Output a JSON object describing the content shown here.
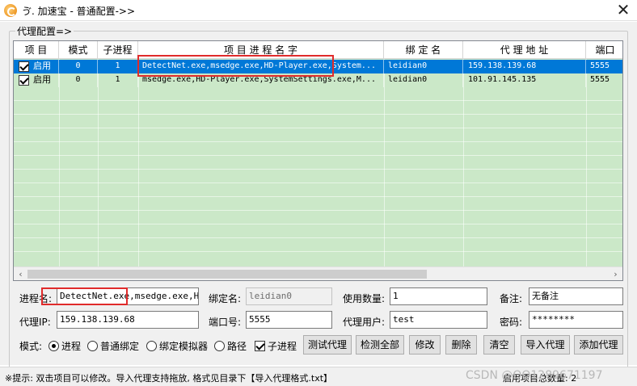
{
  "window": {
    "title": "ゔ. 加速宝 - 普通配置->>",
    "close_symbol": "✕"
  },
  "group_label": "代理配置=>",
  "table": {
    "headers": [
      "项 目",
      "模式",
      "子进程",
      "项 目 进 程 名 字",
      "绑 定 名",
      "代 理 地 址",
      "端口"
    ],
    "rows": [
      {
        "enabled": "启用",
        "mode": "0",
        "sub": "1",
        "processes": "DetectNet.exe,msedge.exe,HD-Player.exe,System...",
        "bind": "leidian0",
        "address": "159.138.139.68",
        "port": "5555"
      },
      {
        "enabled": "启用",
        "mode": "0",
        "sub": "1",
        "processes": "msedge.exe,HD-Player.exe,SystemSettings.exe,M...",
        "bind": "leidian0",
        "address": "101.91.145.135",
        "port": "5555"
      }
    ],
    "scroll_right": "›",
    "scroll_left": "‹"
  },
  "form": {
    "process_label": "进程名:",
    "process_value": "DetectNet.exe,msedge.exe,HD-",
    "bind_label": "绑定名:",
    "bind_value": "leidian0",
    "use_count_label": "使用数量:",
    "use_count_value": "1",
    "note_label": "备注:",
    "note_value": "无备注",
    "proxy_ip_label": "代理IP:",
    "proxy_ip_value": "159.138.139.68",
    "port_label": "端口号:",
    "port_value": "5555",
    "proxy_user_label": "代理用户:",
    "proxy_user_value": "test",
    "password_label": "密码:",
    "password_value": "********"
  },
  "mode": {
    "label": "模式:",
    "options": [
      "进程",
      "普通绑定",
      "绑定模拟器",
      "路径"
    ],
    "selected": "进程",
    "subprocess_label": "子进程"
  },
  "buttons": [
    "测试代理",
    "检测全部",
    "修改",
    "删除",
    "清空",
    "导入代理",
    "添加代理"
  ],
  "status": {
    "hint": "※提示: 双击项目可以修改。导入代理支持拖放, 格式见目录下【导入代理格式.txt】",
    "count": "启用项目总数量: 2",
    "watermark": "CSDN @QQ1289671197"
  }
}
